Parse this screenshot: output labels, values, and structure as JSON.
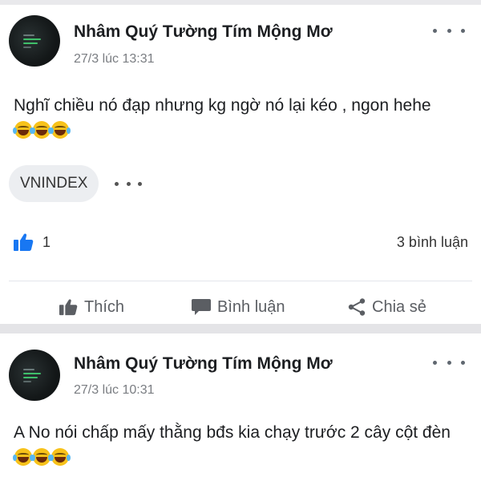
{
  "posts": [
    {
      "author": "Nhâm Quý Tường Tím Mộng Mơ",
      "time": "27/3 lúc 13:31",
      "text": "Nghĩ chiều nó đạp nhưng kg ngờ nó lại kéo , ngon hehe",
      "emoji": [
        "laughing-tears",
        "laughing-tears",
        "laughing-tears"
      ],
      "tag": "VNINDEX",
      "like_count": "1",
      "comment_count": "3 bình luận",
      "actions": {
        "like": "Thích",
        "comment": "Bình luận",
        "share": "Chia sẻ"
      }
    },
    {
      "author": "Nhâm Quý Tường Tím Mộng Mơ",
      "time": "27/3 lúc 10:31",
      "text": "A No nói chấp mấy thằng bđs kia chạy trước 2 cây cột đèn",
      "emoji": [
        "laughing-tears",
        "laughing-tears",
        "laughing-tears"
      ]
    }
  ],
  "colors": {
    "like_blue": "#1877f2",
    "muted_text": "#7a7d82",
    "action_text": "#5b5e63",
    "separator": "#e4e4e7"
  }
}
